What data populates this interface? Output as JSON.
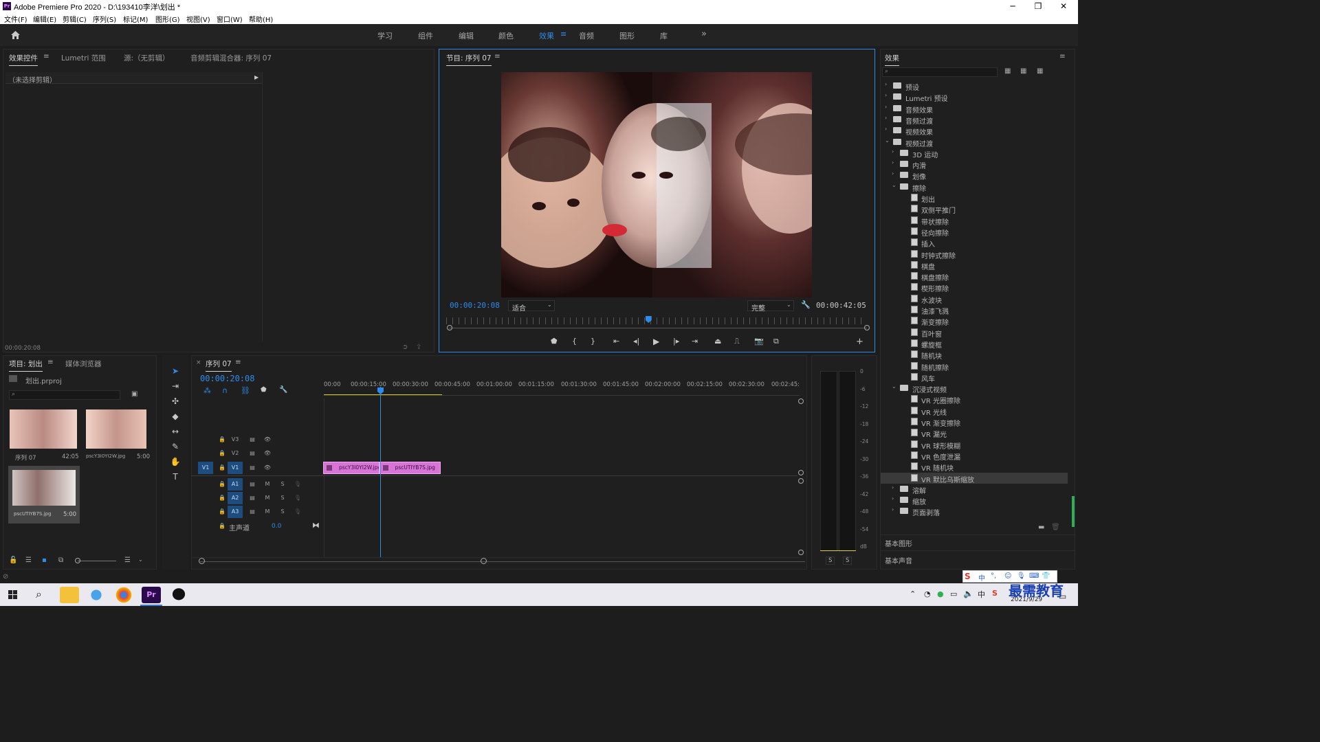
{
  "window": {
    "title": "Adobe Premiere Pro 2020 - D:\\193410李洋\\划出 *",
    "controls": [
      "─",
      "❐",
      "✕"
    ]
  },
  "menu": [
    "文件(F)",
    "编辑(E)",
    "剪辑(C)",
    "序列(S)",
    "标记(M)",
    "图形(G)",
    "视图(V)",
    "窗口(W)",
    "帮助(H)"
  ],
  "workspaces": [
    "学习",
    "组件",
    "编辑",
    "颜色",
    "效果",
    "音频",
    "图形",
    "库"
  ],
  "workspace_more": "»",
  "source_panel": {
    "tabs": [
      "效果控件",
      "Lumetri 范围",
      "源:（无剪辑）",
      "音频剪辑混合器: 序列 07"
    ],
    "no_clip": "（未选择剪辑）",
    "timecode": "00:00:20:08"
  },
  "program": {
    "title": "节目: 序列 07",
    "timecode": "00:00:20:08",
    "fit": "适合",
    "quality": "完整",
    "duration": "00:00:42:05",
    "playhead_fraction": 0.48
  },
  "project": {
    "tabs": [
      "项目: 划出",
      "媒体浏览器"
    ],
    "file": "划出.prproj",
    "items": [
      {
        "name": "序列 07",
        "duration": "42:05"
      },
      {
        "name": "pscY3I0YI2W.jpg",
        "duration": "5:00"
      },
      {
        "name": "pscUTIYB7S.jpg",
        "duration": "5:00"
      }
    ]
  },
  "timeline": {
    "title": "序列 07",
    "timecode": "00:00:20:08",
    "ruler": [
      "00:00",
      "00:00:15:00",
      "00:00:30:00",
      "00:00:45:00",
      "00:01:00:00",
      "00:01:15:00",
      "00:01:30:00",
      "00:01:45:00",
      "00:02:00:00",
      "00:02:15:00",
      "00:02:30:00",
      "00:02:45:"
    ],
    "video_tracks": [
      "V3",
      "V2",
      "V1"
    ],
    "audio_tracks": [
      "A1",
      "A2",
      "A3"
    ],
    "source_patch": "V1",
    "master": "主声道",
    "master_value": "0.0",
    "mute_label": "M",
    "solo_label": "S",
    "clips": [
      {
        "name": "pscY3I0YI2W.jpg",
        "start": 0,
        "end": 20
      },
      {
        "name": "pscUTIYB7S.jpg",
        "start": 20,
        "end": 42
      }
    ]
  },
  "meter": {
    "scale": [
      "0",
      "-6",
      "-12",
      "-18",
      "-24",
      "-30",
      "-36",
      "-42",
      "-48",
      "-54",
      "dB"
    ],
    "solo": [
      "S",
      "S"
    ]
  },
  "effects": {
    "title": "效果",
    "tree": [
      {
        "label": "预设",
        "level": 0,
        "type": "folder",
        "expanded": false
      },
      {
        "label": "Lumetri 预设",
        "level": 0,
        "type": "folder",
        "expanded": false
      },
      {
        "label": "音频效果",
        "level": 0,
        "type": "folder",
        "expanded": false
      },
      {
        "label": "音频过渡",
        "level": 0,
        "type": "folder",
        "expanded": false
      },
      {
        "label": "视频效果",
        "level": 0,
        "type": "folder",
        "expanded": false
      },
      {
        "label": "视频过渡",
        "level": 0,
        "type": "folder",
        "expanded": true
      },
      {
        "label": "3D 运动",
        "level": 1,
        "type": "folder",
        "expanded": false
      },
      {
        "label": "内滑",
        "level": 1,
        "type": "folder",
        "expanded": false
      },
      {
        "label": "划像",
        "level": 1,
        "type": "folder",
        "expanded": false
      },
      {
        "label": "擦除",
        "level": 1,
        "type": "folder",
        "expanded": true
      },
      {
        "label": "划出",
        "level": 2,
        "type": "fx"
      },
      {
        "label": "双侧平推门",
        "level": 2,
        "type": "fx"
      },
      {
        "label": "带状擦除",
        "level": 2,
        "type": "fx"
      },
      {
        "label": "径向擦除",
        "level": 2,
        "type": "fx"
      },
      {
        "label": "插入",
        "level": 2,
        "type": "fx"
      },
      {
        "label": "时钟式擦除",
        "level": 2,
        "type": "fx"
      },
      {
        "label": "棋盘",
        "level": 2,
        "type": "fx"
      },
      {
        "label": "棋盘擦除",
        "level": 2,
        "type": "fx"
      },
      {
        "label": "楔形擦除",
        "level": 2,
        "type": "fx"
      },
      {
        "label": "水波块",
        "level": 2,
        "type": "fx"
      },
      {
        "label": "油漆飞溅",
        "level": 2,
        "type": "fx"
      },
      {
        "label": "渐变擦除",
        "level": 2,
        "type": "fx"
      },
      {
        "label": "百叶窗",
        "level": 2,
        "type": "fx"
      },
      {
        "label": "螺旋框",
        "level": 2,
        "type": "fx"
      },
      {
        "label": "随机块",
        "level": 2,
        "type": "fx"
      },
      {
        "label": "随机擦除",
        "level": 2,
        "type": "fx"
      },
      {
        "label": "风车",
        "level": 2,
        "type": "fx"
      },
      {
        "label": "沉浸式视频",
        "level": 1,
        "type": "folder",
        "expanded": true
      },
      {
        "label": "VR 光圈擦除",
        "level": 2,
        "type": "fx"
      },
      {
        "label": "VR 光线",
        "level": 2,
        "type": "fx"
      },
      {
        "label": "VR 渐变擦除",
        "level": 2,
        "type": "fx"
      },
      {
        "label": "VR 漏光",
        "level": 2,
        "type": "fx"
      },
      {
        "label": "VR 球形模糊",
        "level": 2,
        "type": "fx"
      },
      {
        "label": "VR 色度泄漏",
        "level": 2,
        "type": "fx"
      },
      {
        "label": "VR 随机块",
        "level": 2,
        "type": "fx"
      },
      {
        "label": "VR 默比乌斯缩放",
        "level": 2,
        "type": "fx",
        "selected": true
      },
      {
        "label": "溶解",
        "level": 1,
        "type": "folder",
        "expanded": false
      },
      {
        "label": "缩放",
        "level": 1,
        "type": "folder",
        "expanded": false
      },
      {
        "label": "页面剥落",
        "level": 1,
        "type": "folder",
        "expanded": false
      }
    ],
    "sections": [
      "基本图形",
      "基本声音"
    ]
  },
  "taskbar": {
    "date": "2021/9/29",
    "tray": "中",
    "watermark": "最需教育"
  },
  "colors": {
    "accent": "#2d8ceb",
    "clip": "#d873d8",
    "panel_bg": "#1f1f1f",
    "selected_row": "#3a3a3a"
  }
}
